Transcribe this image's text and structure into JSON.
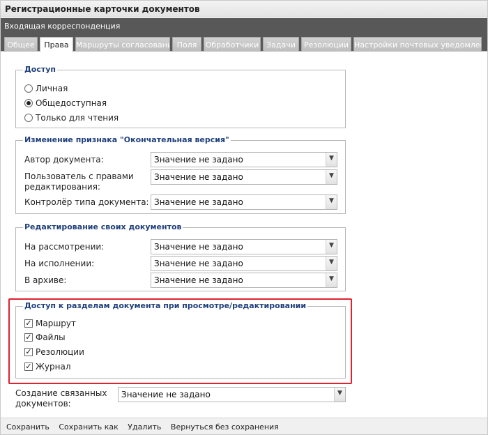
{
  "window": {
    "title": "Регистрационные карточки документов",
    "subtitle": "Входящая корреспонденция"
  },
  "tabs": [
    {
      "label": "Общее",
      "active": false
    },
    {
      "label": "Права",
      "active": true
    },
    {
      "label": "Маршруты согласования",
      "active": false
    },
    {
      "label": "Поля",
      "active": false
    },
    {
      "label": "Обработчики",
      "active": false
    },
    {
      "label": "Задачи",
      "active": false
    },
    {
      "label": "Резолюции",
      "active": false
    },
    {
      "label": "Настройки почтовых уведомлений",
      "active": false
    }
  ],
  "access": {
    "legend": "Доступ",
    "options": [
      {
        "label": "Личная",
        "selected": false
      },
      {
        "label": "Общедоступная",
        "selected": true
      },
      {
        "label": "Только для чтения",
        "selected": false
      }
    ]
  },
  "final_version": {
    "legend": "Изменение признака \"Окончательная версия\"",
    "fields": [
      {
        "label": "Автор документа:",
        "value": "Значение не задано"
      },
      {
        "label": "Пользователь с правами редактирования:",
        "value": "Значение не задано"
      },
      {
        "label": "Контролёр типа документа:",
        "value": "Значение не задано"
      }
    ]
  },
  "own_docs": {
    "legend": "Редактирование своих документов",
    "fields": [
      {
        "label": "На рассмотрении:",
        "value": "Значение не задано"
      },
      {
        "label": "На исполнении:",
        "value": "Значение не задано"
      },
      {
        "label": "В архиве:",
        "value": "Значение не задано"
      }
    ]
  },
  "sections_access": {
    "legend": "Доступ к разделам документа при просмотре/редактировании",
    "items": [
      {
        "label": "Маршрут",
        "checked": true
      },
      {
        "label": "Файлы",
        "checked": true
      },
      {
        "label": "Резолюции",
        "checked": true
      },
      {
        "label": "Журнал",
        "checked": true
      }
    ]
  },
  "linked_docs": {
    "label": "Создание связанных документов:",
    "value": "Значение не задано"
  },
  "footer": {
    "save": "Сохранить",
    "save_as": "Сохранить как",
    "delete": "Удалить",
    "back": "Вернуться без сохранения"
  },
  "colors": {
    "legend_text": "#1f3f7a",
    "highlight_border": "#e0212f",
    "header_bg": "#585858"
  }
}
